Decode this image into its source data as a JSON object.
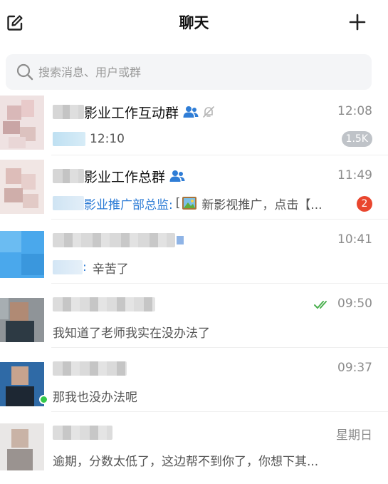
{
  "header": {
    "title": "聊天",
    "edit_icon": "edit-icon",
    "add_icon": "plus-icon"
  },
  "search": {
    "placeholder": "搜索消息、用户或群"
  },
  "colors": {
    "accent": "#2f7dd6",
    "badge_red": "#e9462e",
    "badge_gray": "#bfc3c8",
    "online": "#32c84a",
    "read_check": "#4cb050"
  },
  "chats": [
    {
      "name": "影业工作互动群",
      "time": "12:08",
      "preview_text": "12:10",
      "badge": "1.5K",
      "is_group": true,
      "muted": true
    },
    {
      "name": "影业工作总群",
      "time": "11:49",
      "sender": "影业推广部总监:",
      "preview_prefix": "[",
      "preview_text": "新影视推广，点击【...",
      "badge": "2",
      "is_group": true
    },
    {
      "time": "10:41",
      "sender": ":",
      "preview_text": "辛苦了"
    },
    {
      "time": "09:50",
      "preview_text": "我知道了老师我实在没办法了",
      "read": true
    },
    {
      "time": "09:37",
      "preview_text": "那我也没办法呢",
      "online": true
    },
    {
      "time": "星期日",
      "preview_text": "逾期，分数太低了，这边帮不到你了，你想下其..."
    }
  ]
}
